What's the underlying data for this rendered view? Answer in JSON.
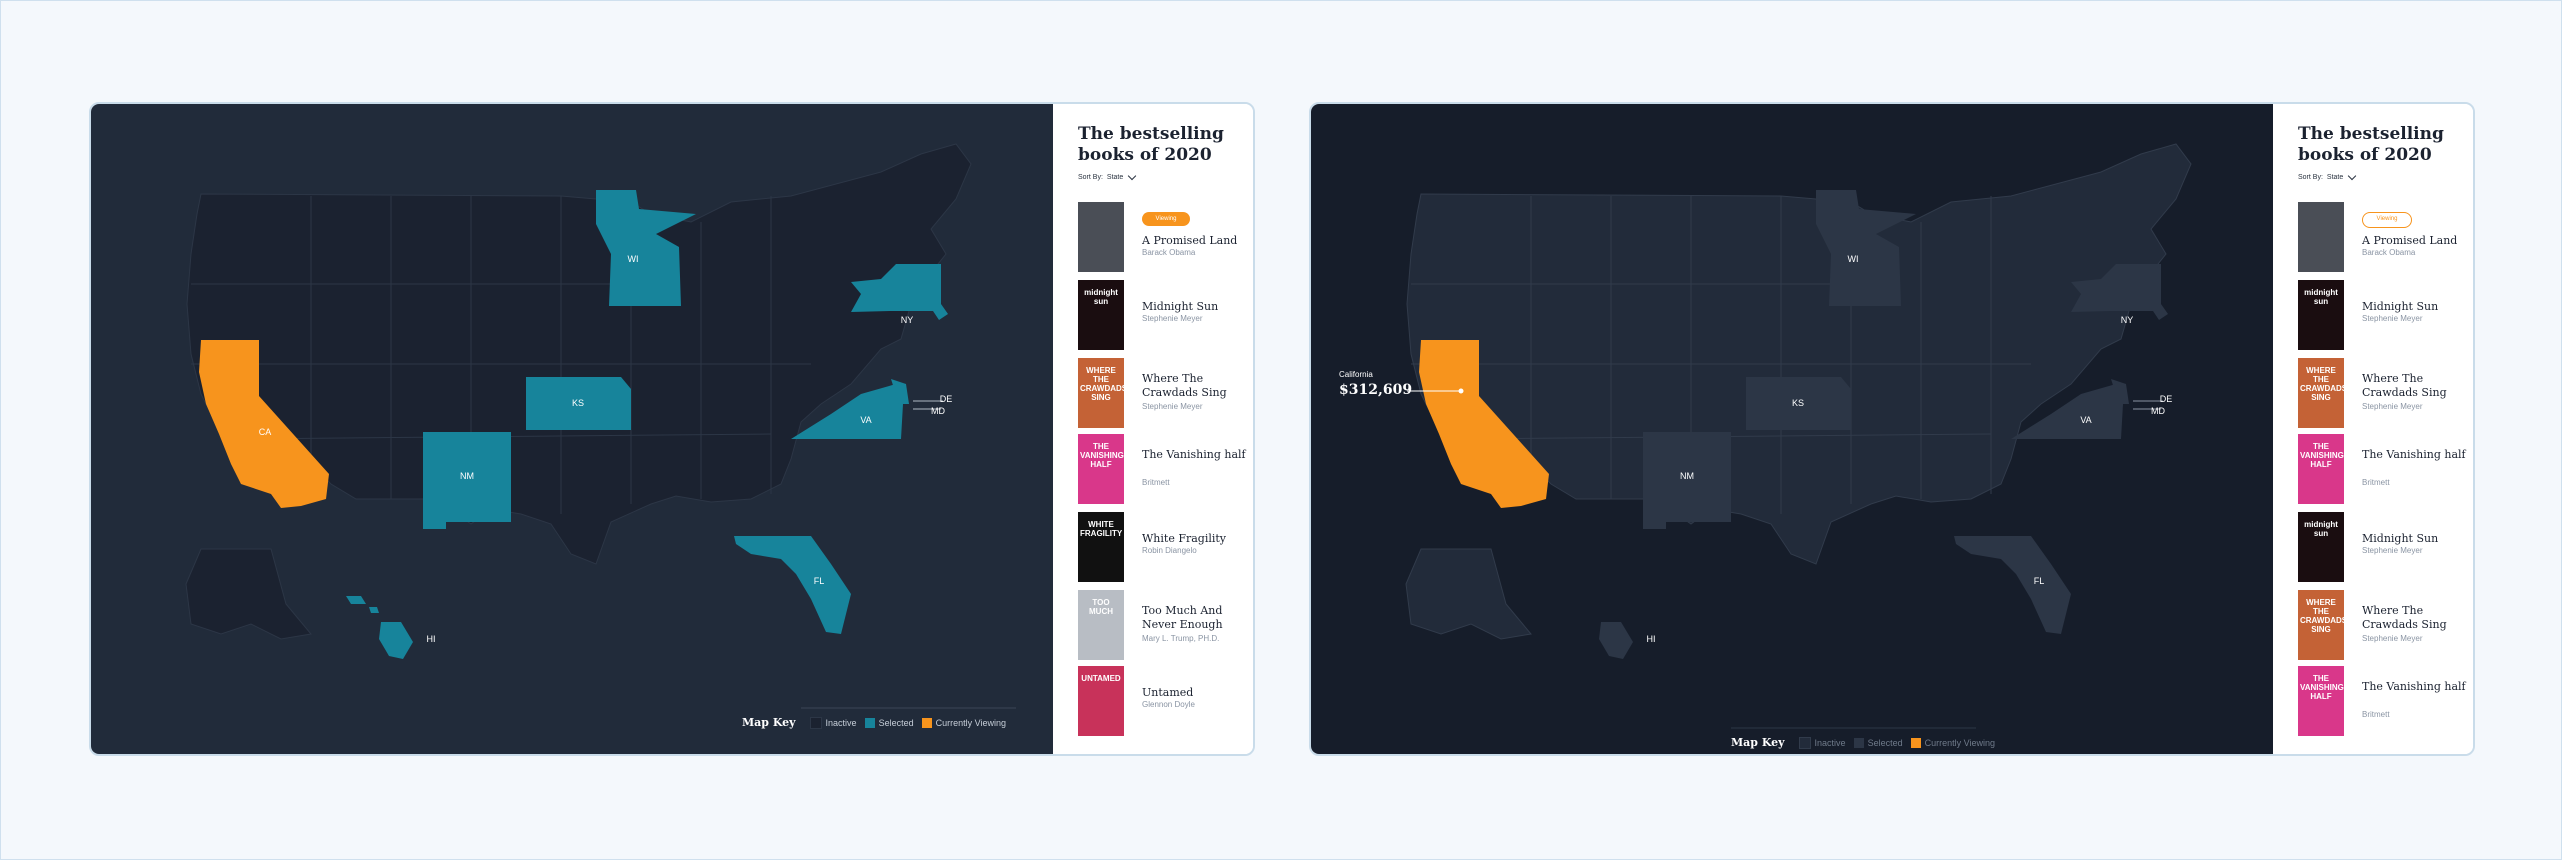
{
  "colors": {
    "selected": "#17849b",
    "viewing": "#f7941d",
    "inactive": "#1b2230",
    "dim_selected": "#2c3646",
    "dim_inactive": "#222b3a"
  },
  "panel_left": {
    "sidebar": {
      "title": "The bestselling books of 2020",
      "sort_label": "Sort By:",
      "sort_value": "State",
      "badge": "Viewing",
      "books": [
        {
          "title": "A Promised Land",
          "author": "Barack Obama",
          "cover_color": "#4a4e56",
          "cover_text": ""
        },
        {
          "title": "Midnight Sun",
          "author": "Stephenie Meyer",
          "cover_color": "#1a0d10",
          "cover_text": "midnight sun"
        },
        {
          "title": "Where The Crawdads Sing",
          "author": "Stephenie Meyer",
          "cover_color": "#c46236",
          "cover_text": "WHERE THE CRAWDADS SING"
        },
        {
          "title": "The Vanishing half",
          "author": "Britmett",
          "cover_color": "#d9378a",
          "cover_text": "THE VANISHING HALF"
        },
        {
          "title": "White Fragility",
          "author": "Robin Diangelo",
          "cover_color": "#111111",
          "cover_text": "WHITE FRAGILITY"
        },
        {
          "title": "Too Much And Never Enough",
          "author": "Mary L. Trump, PH.D.",
          "cover_color": "#b8bdc4",
          "cover_text": "TOO MUCH"
        },
        {
          "title": "Untamed",
          "author": "Glennon Doyle",
          "cover_color": "#c8325a",
          "cover_text": "UNTAMED"
        }
      ]
    },
    "map_key": {
      "title": "Map Key",
      "inactive": "Inactive",
      "selected": "Selected",
      "viewing": "Currently Viewing"
    },
    "states": [
      "CA",
      "WI",
      "NY",
      "KS",
      "NM",
      "VA",
      "DE",
      "MD",
      "FL",
      "HI"
    ]
  },
  "panel_right": {
    "sidebar": {
      "title": "The bestselling books of 2020",
      "sort_label": "Sort By:",
      "sort_value": "State",
      "badge": "Viewing",
      "books": [
        {
          "title": "A Promised Land",
          "author": "Barack Obama",
          "cover_color": "#4a4e56",
          "cover_text": ""
        },
        {
          "title": "Midnight Sun",
          "author": "Stephenie Meyer",
          "cover_color": "#1a0d10",
          "cover_text": "midnight sun"
        },
        {
          "title": "Where The Crawdads Sing",
          "author": "Stephenie Meyer",
          "cover_color": "#c46236",
          "cover_text": "WHERE THE CRAWDADS SING"
        },
        {
          "title": "The Vanishing half",
          "author": "Britmett",
          "cover_color": "#d9378a",
          "cover_text": "THE VANISHING HALF"
        },
        {
          "title": "Midnight Sun",
          "author": "Stephenie Meyer",
          "cover_color": "#1a0d10",
          "cover_text": "midnight sun"
        },
        {
          "title": "Where The Crawdads Sing",
          "author": "Stephenie Meyer",
          "cover_color": "#c46236",
          "cover_text": "WHERE THE CRAWDADS SING"
        },
        {
          "title": "The Vanishing half",
          "author": "Britmett",
          "cover_color": "#d9378a",
          "cover_text": "THE VANISHING HALF"
        }
      ]
    },
    "map_key": {
      "title": "Map Key",
      "inactive": "Inactive",
      "selected": "Selected",
      "viewing": "Currently Viewing"
    },
    "tooltip": {
      "state": "California",
      "value": "$312,609"
    },
    "states": [
      "WI",
      "NY",
      "KS",
      "NM",
      "VA",
      "DE",
      "MD",
      "FL",
      "HI"
    ]
  }
}
